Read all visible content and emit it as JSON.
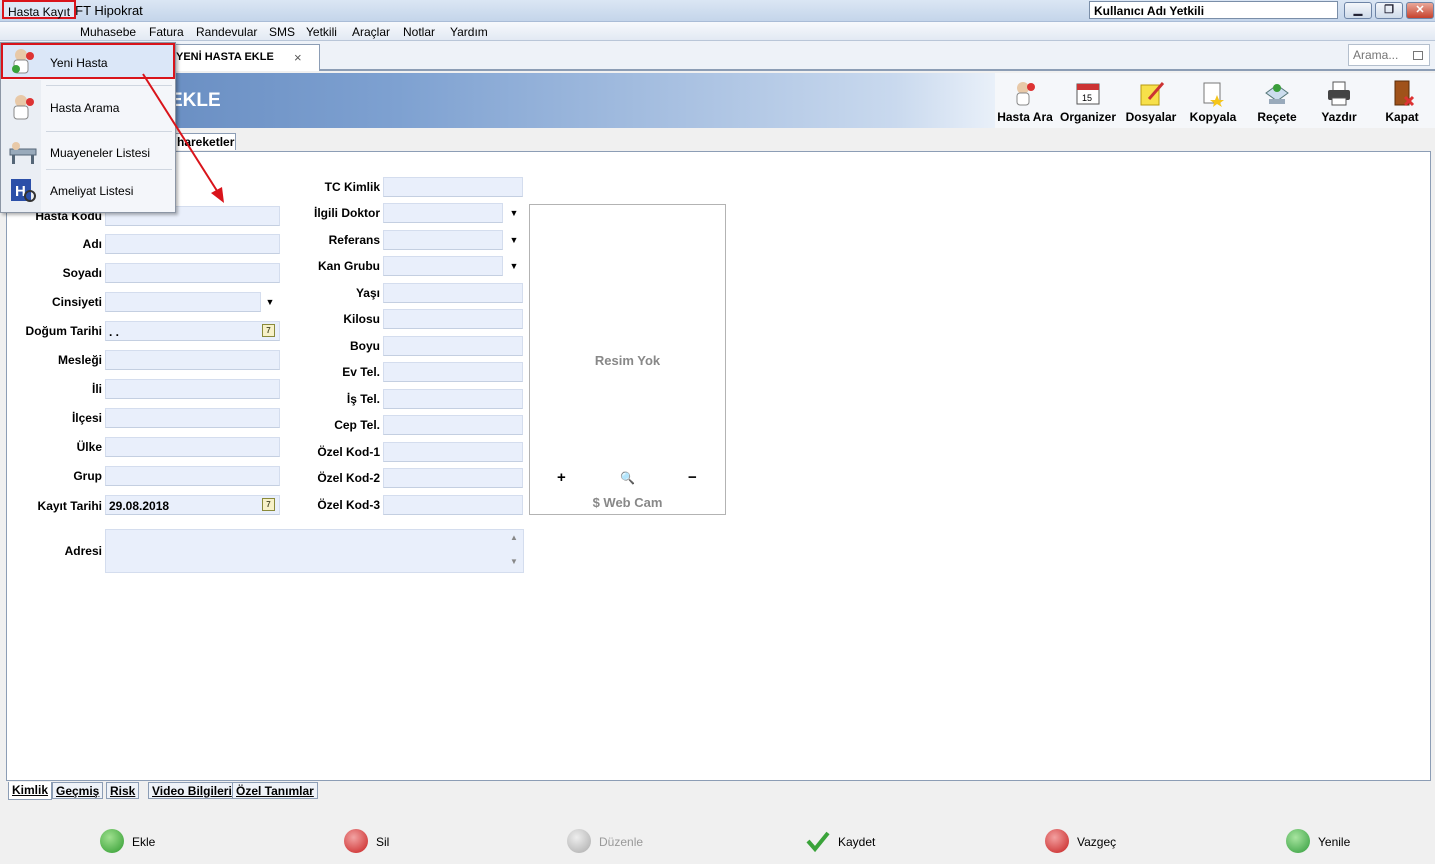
{
  "window": {
    "title": "AKINSOFT Hipokrat",
    "user_label": "Kullanıcı Adı Yetkili",
    "min": "▁",
    "restore": "❐",
    "close": "✕"
  },
  "menubar": [
    "Hasta Kayıt",
    "Muhasebe",
    "Fatura",
    "Randevular",
    "SMS",
    "Yetkili",
    "Araçlar",
    "Notlar",
    "Yardım"
  ],
  "dropdown": [
    "Yeni Hasta",
    "Hasta Arama",
    "Muayeneler Listesi",
    "Ameliyat Listesi"
  ],
  "doc_tab": {
    "label": "YENİ HASTA EKLE",
    "close": "×"
  },
  "search": {
    "placeholder": "Arama..."
  },
  "banner": {
    "title": "EKLE"
  },
  "toolbar": [
    "Hasta Ara",
    "Organizer",
    "Dosyalar",
    "Kopyala",
    "Reçete",
    "Yazdır",
    "Kapat"
  ],
  "subtab": {
    "label": "hareketleri"
  },
  "form_left": {
    "labels": [
      "Hasta Kodu",
      "Adı",
      "Soyadı",
      "Cinsiyeti",
      "Doğum Tarihi",
      "Mesleği",
      "İli",
      "İlçesi",
      "Ülke",
      "Grup",
      "Kayıt Tarihi"
    ],
    "dogum_value": " . .",
    "kayit_value": "29.08.2018",
    "calendar_glyph": "7",
    "dropdown_glyph": "▼"
  },
  "form_right": {
    "labels": [
      "TC Kimlik",
      "İlgili Doktor",
      "Referans",
      "Kan Grubu",
      "Yaşı",
      "Kilosu",
      "Boyu",
      "Ev Tel.",
      "İş Tel.",
      "Cep Tel.",
      "Özel Kod-1",
      "Özel Kod-2",
      "Özel Kod-3"
    ]
  },
  "photo": {
    "empty_text": "Resim Yok",
    "zoom_in": "+",
    "zoom": "🔍",
    "zoom_out": "−",
    "webcam": "Web Cam",
    "webcam_icon": "$"
  },
  "adres": {
    "label": "Adresi"
  },
  "bottom_tabs": [
    "Kimlik",
    "Geçmiş",
    "Risk",
    "Video Bilgileri",
    "Özel Tanımlar"
  ],
  "actions": [
    "Ekle",
    "Sil",
    "Düzenle",
    "Kaydet",
    "Vazgeç",
    "Yenile"
  ],
  "colors": {
    "accent": "#d9141b",
    "field_bg": "#e9effb",
    "banner": "#5c82b9"
  }
}
